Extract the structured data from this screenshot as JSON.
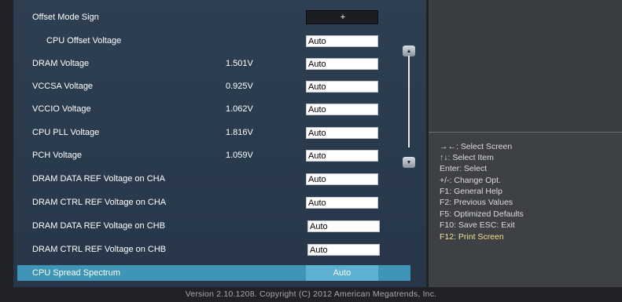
{
  "settings": [
    {
      "label": "Offset Mode Sign",
      "value": "",
      "field": "+"
    },
    {
      "label": "CPU Offset Voltage",
      "value": "",
      "field": "Auto"
    },
    {
      "label": "DRAM Voltage",
      "value": "1.501V",
      "field": "Auto"
    },
    {
      "label": "VCCSA Voltage",
      "value": "0.925V",
      "field": "Auto"
    },
    {
      "label": "VCCIO Voltage",
      "value": "1.062V",
      "field": "Auto"
    },
    {
      "label": "CPU PLL Voltage",
      "value": "1.816V",
      "field": "Auto"
    },
    {
      "label": "PCH Voltage",
      "value": "1.059V",
      "field": "Auto"
    },
    {
      "label": "DRAM DATA REF Voltage on CHA",
      "value": "",
      "field": "Auto"
    },
    {
      "label": "DRAM CTRL REF Voltage on CHA",
      "value": "",
      "field": "Auto"
    },
    {
      "label": "DRAM DATA REF Voltage on CHB",
      "value": "",
      "field": "Auto"
    },
    {
      "label": "DRAM CTRL REF Voltage on CHB",
      "value": "",
      "field": "Auto"
    },
    {
      "label": "CPU Spread Spectrum",
      "value": "",
      "field": "Auto"
    }
  ],
  "help": [
    "→←: Select Screen",
    "↑↓: Select Item",
    "Enter: Select",
    "+/-: Change Opt.",
    "F1: General Help",
    "F2: Previous Values",
    "F5: Optimized Defaults",
    "F10: Save   ESC: Exit",
    "F12: Print Screen"
  ],
  "scroll": {
    "up": "▲",
    "down": "▼"
  },
  "footer": "Version  2.10.1208.  Copyright  (C)  2012  American  Megatrends,  Inc.",
  "colors": {
    "selected_row": "#3f95b6",
    "help_highlight": "#f3e38a",
    "panel": "#2e3f52"
  }
}
